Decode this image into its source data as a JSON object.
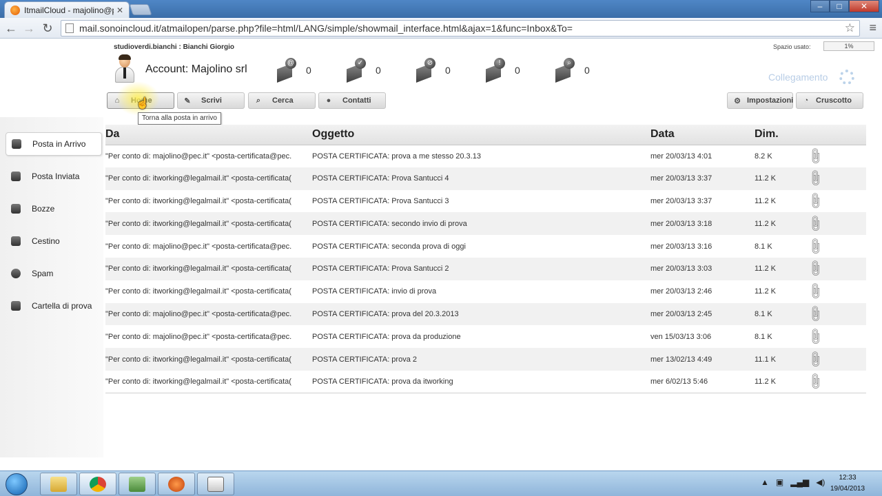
{
  "browser": {
    "tab_title": "ItmailCloud - majolino@p",
    "tab_close": "✕",
    "url": "mail.sonoincloud.it/atmailopen/parse.php?file=html/LANG/simple/showmail_interface.html&ajax=1&func=Inbox&To="
  },
  "header": {
    "user_line": "studioverdi.bianchi : Bianchi Giorgio",
    "space_label": "Spazio usato:",
    "space_value": "1%",
    "account_title": "Account: Majolino srl",
    "connection_status": "Collegamento"
  },
  "stats": [
    {
      "icon": "mail-at-icon",
      "glyph": "@",
      "count": "0"
    },
    {
      "icon": "mail-check-icon",
      "glyph": "✓",
      "count": "0"
    },
    {
      "icon": "mail-stop-icon",
      "glyph": "⊘",
      "count": "0"
    },
    {
      "icon": "mail-alert-icon",
      "glyph": "!",
      "count": "0"
    },
    {
      "icon": "mail-search-icon",
      "glyph": "⌕",
      "count": "0"
    }
  ],
  "nav": {
    "home": "Home",
    "write": "Scrivi",
    "search": "Cerca",
    "contacts": "Contatti",
    "settings": "Impostazioni",
    "dashboard": "Cruscotto",
    "tooltip": "Torna alla posta in arrivo"
  },
  "folders": [
    "Posta in Arrivo",
    "Posta Inviata",
    "Bozze",
    "Cestino",
    "Spam",
    "Cartella di prova"
  ],
  "table": {
    "headers": {
      "from": "Da",
      "subject": "Oggetto",
      "date": "Data",
      "size": "Dim."
    },
    "rows": [
      {
        "from": "\"Per conto di: majolino@pec.it\" <posta-certificata@pec.",
        "subject": "POSTA CERTIFICATA: prova a me stesso 20.3.13",
        "date": "mer 20/03/13 4:01",
        "size": "8.2 K"
      },
      {
        "from": "\"Per conto di: itworking@legalmail.it\" <posta-certificata(",
        "subject": "POSTA CERTIFICATA: Prova Santucci 4",
        "date": "mer 20/03/13 3:37",
        "size": "11.2 K"
      },
      {
        "from": "\"Per conto di: itworking@legalmail.it\" <posta-certificata(",
        "subject": "POSTA CERTIFICATA: Prova Santucci 3",
        "date": "mer 20/03/13 3:37",
        "size": "11.2 K"
      },
      {
        "from": "\"Per conto di: itworking@legalmail.it\" <posta-certificata(",
        "subject": "POSTA CERTIFICATA: secondo invio di prova",
        "date": "mer 20/03/13 3:18",
        "size": "11.2 K"
      },
      {
        "from": "\"Per conto di: majolino@pec.it\" <posta-certificata@pec.",
        "subject": "POSTA CERTIFICATA: seconda prova di oggi",
        "date": "mer 20/03/13 3:16",
        "size": "8.1 K"
      },
      {
        "from": "\"Per conto di: itworking@legalmail.it\" <posta-certificata(",
        "subject": "POSTA CERTIFICATA: Prova Santucci 2",
        "date": "mer 20/03/13 3:03",
        "size": "11.2 K"
      },
      {
        "from": "\"Per conto di: itworking@legalmail.it\" <posta-certificata(",
        "subject": "POSTA CERTIFICATA: invio di prova",
        "date": "mer 20/03/13 2:46",
        "size": "11.2 K"
      },
      {
        "from": "\"Per conto di: majolino@pec.it\" <posta-certificata@pec.",
        "subject": "POSTA CERTIFICATA: prova del 20.3.2013",
        "date": "mer 20/03/13 2:45",
        "size": "8.1 K"
      },
      {
        "from": "\"Per conto di: majolino@pec.it\" <posta-certificata@pec.",
        "subject": "POSTA CERTIFICATA: prova da produzione",
        "date": "ven 15/03/13 3:06",
        "size": "8.1 K"
      },
      {
        "from": "\"Per conto di: itworking@legalmail.it\" <posta-certificata(",
        "subject": "POSTA CERTIFICATA: prova 2",
        "date": "mer 13/02/13 4:49",
        "size": "11.1 K"
      },
      {
        "from": "\"Per conto di: itworking@legalmail.it\" <posta-certificata(",
        "subject": "POSTA CERTIFICATA: prova da itworking",
        "date": "mer 6/02/13 5:46",
        "size": "11.2 K"
      }
    ]
  },
  "taskbar": {
    "time": "12:33",
    "date": "19/04/2013"
  },
  "colors": {
    "accent": "#3a6ea8",
    "connection": "#b8cde6",
    "tooltip_border": "#767676"
  }
}
